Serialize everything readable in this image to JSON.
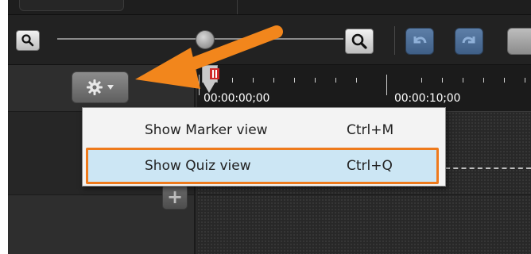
{
  "icons": {
    "zoom_out": "magnifier-minus-icon",
    "zoom_in": "magnifier-plus-icon",
    "undo": "undo-icon",
    "redo": "redo-icon",
    "gear": "gear-icon",
    "dropdown": "chevron-down-icon",
    "add": "plus-icon",
    "callout": "orange-arrow-icon"
  },
  "timeline": {
    "timecodes": [
      "00:00:00;00",
      "00:00:10;00"
    ]
  },
  "context_menu": {
    "items": [
      {
        "label": "Show Marker view",
        "shortcut": "Ctrl+M"
      },
      {
        "label": "Show Quiz view",
        "shortcut": "Ctrl+Q"
      }
    ]
  },
  "colors": {
    "highlight_border": "#ee7a1c",
    "selected_bg": "#cce6f4",
    "arrow": "#f2861c",
    "toolbar_button": "#4f6f96"
  },
  "zoom": {
    "level": 0.52
  }
}
